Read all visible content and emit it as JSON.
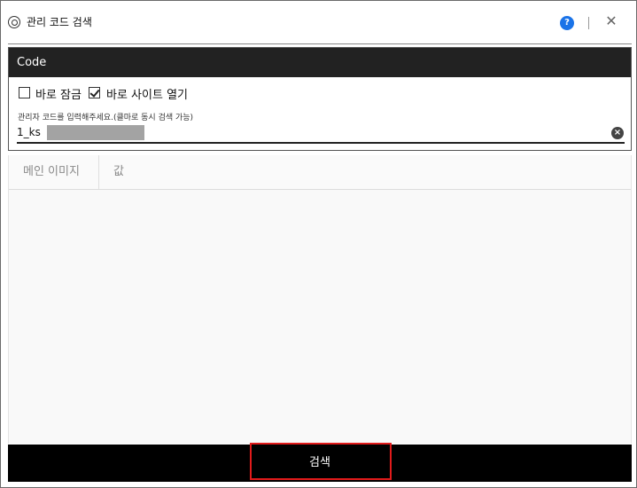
{
  "window": {
    "title": "관리 코드 검색"
  },
  "panel": {
    "header": "Code",
    "checkboxes": [
      {
        "label": "바로 잠금",
        "checked": false
      },
      {
        "label": "바로 사이트 열기",
        "checked": true
      }
    ],
    "field": {
      "label": "관리자 코드를 입력해주세요.(클마로 동시 검색 가능)",
      "value": "1_ks"
    }
  },
  "table": {
    "columns": [
      "메인 이미지",
      "값"
    ]
  },
  "footer": {
    "search_label": "검색"
  },
  "icons": {
    "app": "app-logo-icon",
    "help": "help-icon",
    "close": "close-icon",
    "clear": "clear-input-icon",
    "check": "checkmark-icon"
  },
  "colors": {
    "header_bg": "#222222",
    "button_bg": "#000000",
    "highlight": "#e21b1b",
    "help": "#1a73e8"
  }
}
